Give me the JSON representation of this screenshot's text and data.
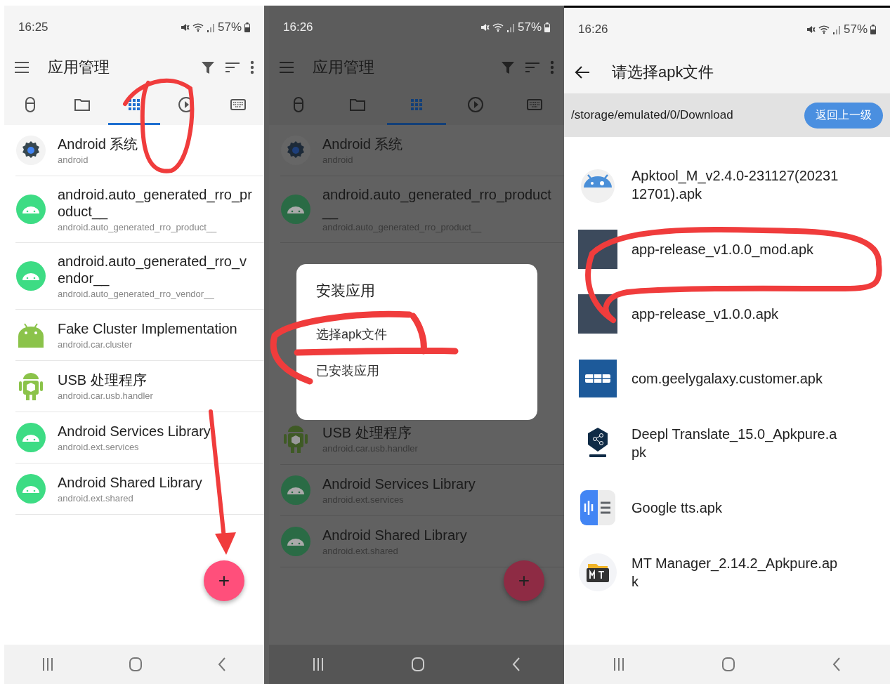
{
  "app_manager_screen": {
    "dimmed": false,
    "status_bar": {
      "time": "16:25",
      "battery": "57%"
    },
    "title": "应用管理",
    "tabs": [
      {
        "selected": false
      },
      {
        "selected": false
      },
      {
        "selected": true
      },
      {
        "selected": false
      },
      {
        "selected": false
      }
    ],
    "apps_top": [
      {
        "kind": "gear",
        "name": "Android 系统",
        "package": "android"
      },
      {
        "kind": "android_round",
        "name": "android.auto_generated_rro_product__",
        "package": "android.auto_generated_rro_product__"
      },
      {
        "kind": "android_round",
        "name": "android.auto_generated_rro_vendor__",
        "package": "android.auto_generated_rro_vendor__"
      },
      {
        "kind": "android_flat",
        "name": "Fake Cluster Implementation",
        "package": "android.car.cluster"
      }
    ],
    "apps_bottom": [
      {
        "kind": "android_box",
        "name": "USB 处理程序",
        "package": "android.car.usb.handler"
      },
      {
        "kind": "android_round",
        "name": "Android Services Library",
        "package": "android.ext.services"
      },
      {
        "kind": "android_round",
        "name": "Android Shared Library",
        "package": "android.ext.shared"
      }
    ],
    "fab": "+"
  },
  "install_dialog_screen": {
    "dimmed": true,
    "status_bar": {
      "time": "16:26",
      "battery": "57%"
    },
    "title": "应用管理",
    "tabs": [
      {
        "selected": false
      },
      {
        "selected": false
      },
      {
        "selected": true
      },
      {
        "selected": false
      },
      {
        "selected": false
      }
    ],
    "apps_top": [
      {
        "kind": "gear",
        "name": "Android 系统",
        "package": "android"
      },
      {
        "kind": "android_round",
        "name": "android.auto_generated_rro_product__",
        "package": "android.auto_generated_rro_product__"
      }
    ],
    "apps_bottom": [
      {
        "kind": "android_box",
        "name": "USB 处理程序",
        "package": "android.car.usb.handler"
      },
      {
        "kind": "android_round",
        "name": "Android Services Library",
        "package": "android.ext.services"
      },
      {
        "kind": "android_round",
        "name": "Android Shared Library",
        "package": "android.ext.shared"
      }
    ],
    "fab": "+",
    "dialog": {
      "title": "安装应用",
      "options": [
        "选择apk文件",
        "已安装应用"
      ]
    }
  },
  "file_picker_screen": {
    "status_bar": {
      "time": "16:26",
      "battery": "57%"
    },
    "title": "请选择apk文件",
    "path": "/storage/emulated/0/Download",
    "up_button": "返回上一级",
    "files": [
      {
        "kind": "apktool",
        "name": "Apktool_M_v2.4.0-231127(2023112701).apk"
      },
      {
        "kind": "thumbnail",
        "name": "app-release_v1.0.0_mod.apk"
      },
      {
        "kind": "thumbnail",
        "name": "app-release_v1.0.0.apk"
      },
      {
        "kind": "grid",
        "name": "com.geelygalaxy.customer.apk"
      },
      {
        "kind": "deepl",
        "name": "Deepl Translate_15.0_Apkpure.apk"
      },
      {
        "kind": "tts",
        "name": "Google tts.apk"
      },
      {
        "kind": "mt",
        "name": "MT Manager_2.14.2_Apkpure.apk"
      }
    ]
  }
}
